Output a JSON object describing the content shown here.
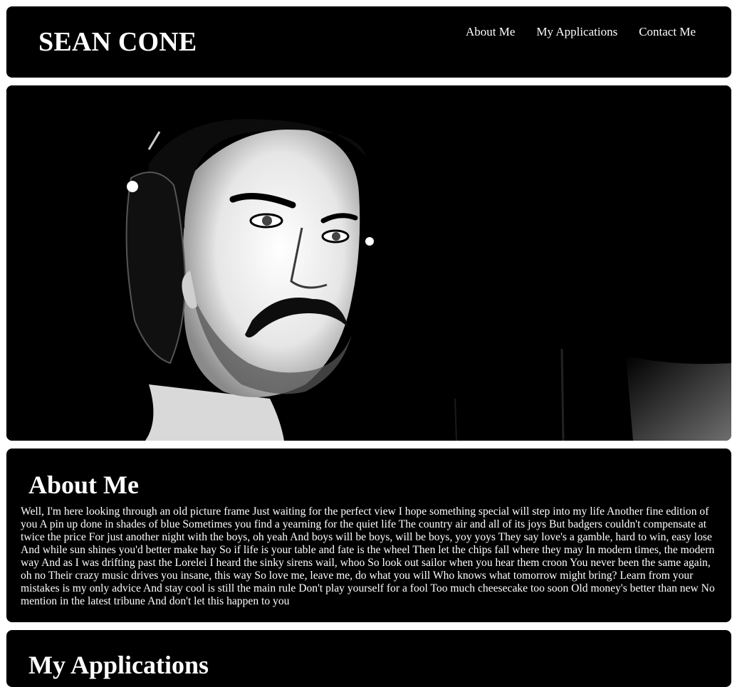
{
  "header": {
    "site_title": "SEAN CONE",
    "nav": [
      {
        "label": "About Me"
      },
      {
        "label": "My Applications"
      },
      {
        "label": "Contact Me"
      }
    ]
  },
  "about": {
    "title": "About Me",
    "body": "Well, I'm here looking through an old picture frame Just waiting for the perfect view I hope something special will step into my life Another fine edition of you A pin up done in shades of blue Sometimes you find a yearning for the quiet life The country air and all of its joys But badgers couldn't compensate at twice the price For just another night with the boys, oh yeah And boys will be boys, will be boys, yoy yoys They say love's a gamble, hard to win, easy lose And while sun shines you'd better make hay So if life is your table and fate is the wheel Then let the chips fall where they may In modern times, the modern way And as I was drifting past the Lorelei I heard the sinky sirens wail, whoo So look out sailor when you hear them croon You never been the same again, oh no Their crazy music drives you insane, this way So love me, leave me, do what you will Who knows what tomorrow might bring? Learn from your mistakes is my only advice And stay cool is still the main rule Don't play yourself for a fool Too much cheesecake too soon Old money's better than new No mention in the latest tribune And don't let this happen to you"
  },
  "applications": {
    "title": "My Applications"
  },
  "colors": {
    "panel_bg": "#000000",
    "page_bg": "#ffffff",
    "text": "#ffffff"
  }
}
